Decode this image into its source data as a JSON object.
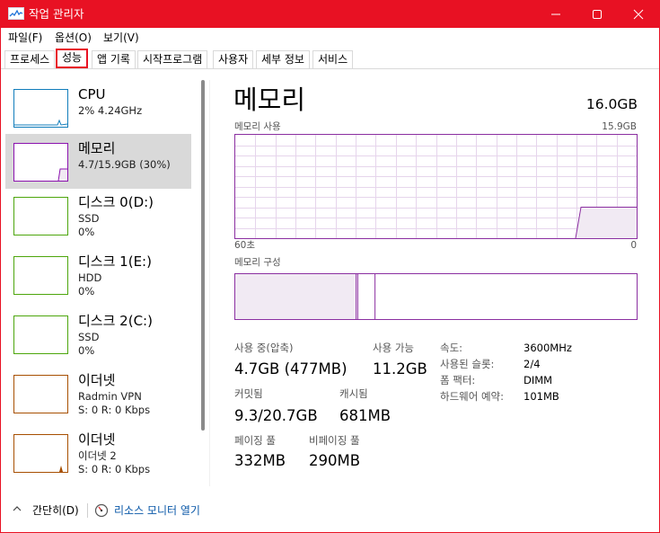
{
  "window": {
    "title": "작업 관리자",
    "accent_color": "#e81123",
    "app_icon": "task-manager-icon",
    "controls": {
      "minimize_icon": "minimize-icon",
      "maximize_icon": "maximize-icon",
      "close_icon": "close-icon"
    }
  },
  "menu": {
    "file": "파일(F)",
    "options": "옵션(O)",
    "view": "보기(V)"
  },
  "tabs": {
    "processes": "프로세스",
    "performance": "성능",
    "app_history": "앱 기록",
    "startup": "시작프로그램",
    "users": "사용자",
    "details": "세부 정보",
    "services": "서비스",
    "active": "성능"
  },
  "sidebar": {
    "items": [
      {
        "name": "CPU",
        "sub1": "2% 4.24GHz",
        "sub2": "",
        "color": "#117dbb",
        "selected": false
      },
      {
        "name": "메모리",
        "sub1": "4.7/15.9GB (30%)",
        "sub2": "",
        "color": "#8b12ae",
        "selected": true
      },
      {
        "name": "디스크 0(D:)",
        "sub1": "SSD",
        "sub2": "0%",
        "color": "#4da60c",
        "selected": false
      },
      {
        "name": "디스크 1(E:)",
        "sub1": "HDD",
        "sub2": "0%",
        "color": "#4da60c",
        "selected": false
      },
      {
        "name": "디스크 2(C:)",
        "sub1": "SSD",
        "sub2": "0%",
        "color": "#4da60c",
        "selected": false
      },
      {
        "name": "이더넷",
        "sub1": "Radmin VPN",
        "sub2": "S: 0 R: 0 Kbps",
        "color": "#a74f01",
        "selected": false
      },
      {
        "name": "이더넷",
        "sub1": "이더넷 2",
        "sub2": "S: 0 R: 0 Kbps",
        "color": "#a74f01",
        "selected": false
      }
    ]
  },
  "main": {
    "title": "메모리",
    "total": "16.0GB",
    "graph": {
      "label": "메모리 사용",
      "max_label": "15.9GB",
      "time_start": "60초",
      "time_end": "0",
      "color": "#8b2fa1",
      "usage_fraction_recent": 0.3,
      "usage_fraction_earlier": 0.0
    },
    "composition": {
      "label": "메모리 구성",
      "in_use_fraction": 0.3,
      "modified_fraction": 0.004,
      "standby_fraction": 0.043,
      "free_fraction": 0.653
    },
    "stats": {
      "in_use_label": "사용 중(압축)",
      "in_use_value": "4.7GB (477MB)",
      "available_label": "사용 가능",
      "available_value": "11.2GB",
      "committed_label": "커밋됨",
      "committed_value": "9.3/20.7GB",
      "cached_label": "캐시됨",
      "cached_value": "681MB",
      "paged_label": "페이징 풀",
      "paged_value": "332MB",
      "nonpaged_label": "비페이징 풀",
      "nonpaged_value": "290MB"
    },
    "info": {
      "speed_key": "속도:",
      "speed_val": "3600MHz",
      "slots_key": "사용된 슬롯:",
      "slots_val": "2/4",
      "form_key": "폼 팩터:",
      "form_val": "DIMM",
      "reserved_key": "하드웨어 예약:",
      "reserved_val": "101MB"
    }
  },
  "footer": {
    "less_details": "간단히(D)",
    "resource_monitor": "리소스 모니터 열기",
    "chevron_icon": "chevron-up-icon",
    "rm_icon": "resource-monitor-icon",
    "link_color": "#0a58a8"
  }
}
